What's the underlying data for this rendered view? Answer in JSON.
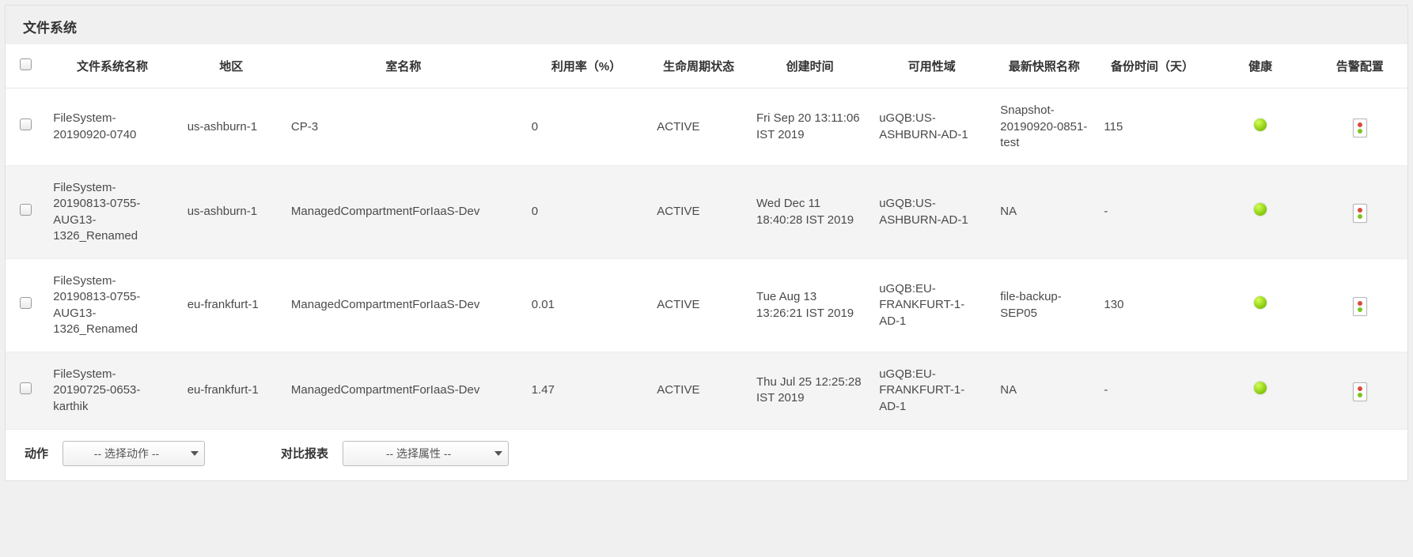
{
  "panel": {
    "title": "文件系统"
  },
  "columns": {
    "checkbox": "",
    "name": "文件系统名称",
    "region": "地区",
    "compartment": "室名称",
    "utilization": "利用率（%）",
    "lifecycle": "生命周期状态",
    "created": "创建时间",
    "ad": "可用性域",
    "snapshot": "最新快照名称",
    "backup_age": "备份时间（天）",
    "health": "健康",
    "alert": "告警配置"
  },
  "rows": [
    {
      "name": "FileSystem-20190920-0740",
      "region": "us-ashburn-1",
      "compartment": "CP-3",
      "utilization": "0",
      "lifecycle": "ACTIVE",
      "created": "Fri Sep 20 13:11:06 IST 2019",
      "ad": "uGQB:US-ASHBURN-AD-1",
      "snapshot": "Snapshot-20190920-0851-test",
      "backup_age": "115",
      "health": "green"
    },
    {
      "name": "FileSystem-20190813-0755-AUG13-1326_Renamed",
      "region": "us-ashburn-1",
      "compartment": "ManagedCompartmentForIaaS-Dev",
      "utilization": "0",
      "lifecycle": "ACTIVE",
      "created": "Wed Dec 11 18:40:28 IST 2019",
      "ad": "uGQB:US-ASHBURN-AD-1",
      "snapshot": "NA",
      "backup_age": "-",
      "health": "green"
    },
    {
      "name": "FileSystem-20190813-0755-AUG13-1326_Renamed",
      "region": "eu-frankfurt-1",
      "compartment": "ManagedCompartmentForIaaS-Dev",
      "utilization": "0.01",
      "lifecycle": "ACTIVE",
      "created": "Tue Aug 13 13:26:21 IST 2019",
      "ad": "uGQB:EU-FRANKFURT-1-AD-1",
      "snapshot": "file-backup-SEP05",
      "backup_age": "130",
      "health": "green"
    },
    {
      "name": "FileSystem-20190725-0653-karthik",
      "region": "eu-frankfurt-1",
      "compartment": "ManagedCompartmentForIaaS-Dev",
      "utilization": "1.47",
      "lifecycle": "ACTIVE",
      "created": "Thu Jul 25 12:25:28 IST 2019",
      "ad": "uGQB:EU-FRANKFURT-1-AD-1",
      "snapshot": "NA",
      "backup_age": "-",
      "health": "green"
    }
  ],
  "footer": {
    "action_label": "动作",
    "action_placeholder": "--  选择动作  --",
    "compare_label": "对比报表",
    "compare_placeholder": "--  选择属性  --"
  }
}
